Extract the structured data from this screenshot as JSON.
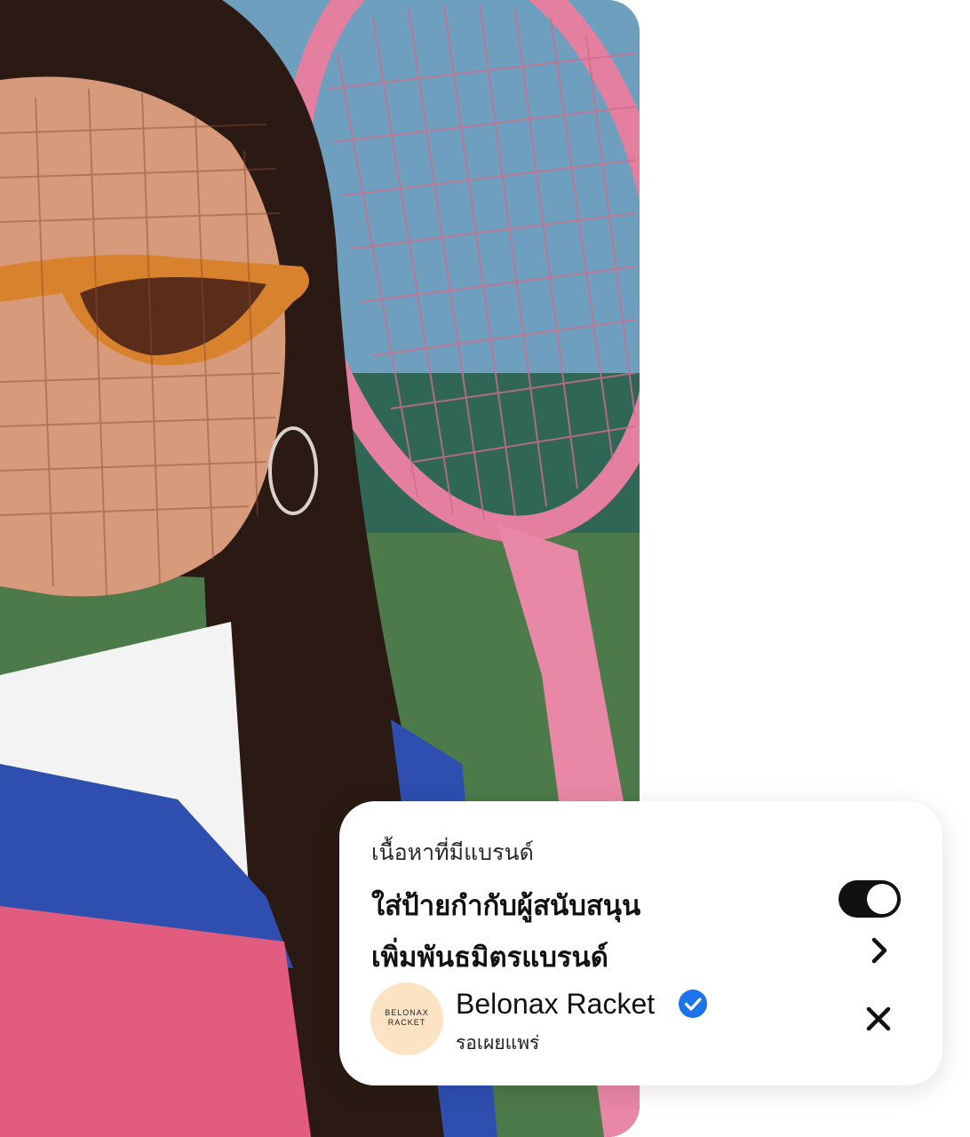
{
  "card": {
    "title": "เนื้อหาที่มีแบรนด์",
    "sponsor_label": "ใส่ป้ายกำกับผู้สนับสนุน",
    "sponsor_toggle_on": true,
    "add_partner_label": "เพิ่มพันธมิตรแบรนด์",
    "partner": {
      "avatar_text": "BELONAX\nRACKET",
      "name": "Belonax Racket",
      "status": "รอเผยแพร่",
      "verified": true
    }
  },
  "icons": {
    "toggle": "toggle-switch-icon",
    "chevron": "chevron-right-icon",
    "verified": "verified-badge-icon",
    "close": "close-icon"
  },
  "colors": {
    "verified_blue": "#1d74e8",
    "toggle_on": "#111111",
    "avatar_bg": "#fbe3c3"
  }
}
